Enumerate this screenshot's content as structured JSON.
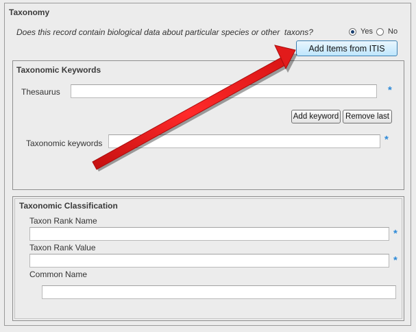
{
  "taxonomy": {
    "title": "Taxonomy",
    "question": "Does this record contain biological data about particular species or other  taxons?",
    "radio_yes": "Yes",
    "radio_no": "No",
    "selected": "Yes",
    "itis_button": "Add Items from ITIS"
  },
  "keywords": {
    "title": "Taxonomic Keywords",
    "thesaurus_label": "Thesaurus",
    "thesaurus_value": "",
    "add_button": "Add keyword",
    "remove_button": "Remove last",
    "keywords_label": "Taxonomic keywords",
    "keywords_value": ""
  },
  "classification": {
    "title": "Taxonomic Classification",
    "rank_name_label": "Taxon Rank Name",
    "rank_name_value": "",
    "rank_value_label": "Taxon Rank Value",
    "rank_value_value": "",
    "common_name_label": "Common Name",
    "common_name_value": ""
  },
  "required_marker": "*",
  "colors": {
    "background": "#ececec",
    "required": "#2e8ad8",
    "arrow": "#e21b1b",
    "itis_button": "#bee6fd"
  }
}
